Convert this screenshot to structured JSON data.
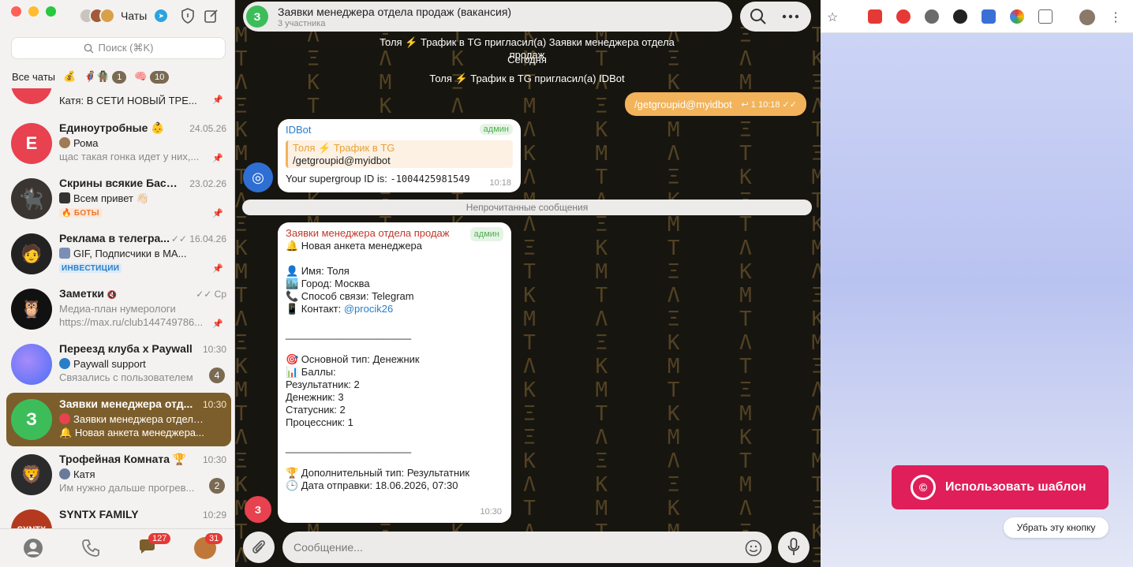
{
  "sidebar": {
    "title": "Чаты",
    "search_placeholder": "Поиск (⌘K)",
    "folders": [
      {
        "label": "Все чаты"
      },
      {
        "label": "💰"
      },
      {
        "label": "🦸🧌",
        "count": "1"
      },
      {
        "label": "🧠",
        "count": "10"
      }
    ],
    "chats": [
      {
        "name": "",
        "line2": "Катя: В СЕТИ НОВЫЙ ТРЕ...",
        "line3": "",
        "time": "",
        "avatar_letter": "",
        "avatar_color": "#e8414f"
      },
      {
        "name": "Единоутробные 👶",
        "line2": "Рома",
        "line3": "щас такая гонка идет у них,...",
        "time": "24.05.26",
        "avatar_letter": "Е",
        "avatar_color": "#e8414f"
      },
      {
        "name": "Скрины всякие Бася...",
        "line2": "Всем привет 👋🏻",
        "line3": "🔥 БОТЫ",
        "time": "23.02.26",
        "avatar_letter": "",
        "avatar_color": "#3a3530"
      },
      {
        "name": "Реклама в телегра...",
        "line2": "GIF, Подписчики в МА...",
        "line3": "ИНВЕСТИЦИИ",
        "time": "16.04.26",
        "avatar_letter": "",
        "avatar_color": "#222"
      },
      {
        "name": "Заметки",
        "line2": "Медиа-план нумерологи",
        "line3": "https://max.ru/club144749786...",
        "time": "Ср",
        "avatar_letter": "",
        "avatar_color": "#111"
      },
      {
        "name": "Переезд клуба х Paywall",
        "line2": "Paywall support",
        "line3": "Связались с пользователем",
        "time": "10:30",
        "count": "4",
        "avatar_letter": "",
        "avatar_color": "#6a5cd6"
      },
      {
        "name": "Заявки менеджера отд...",
        "line2": "Заявки менеджера отдела п...",
        "line3": "Новая анкета менеджера...",
        "time": "10:30",
        "avatar_letter": "З",
        "avatar_color": "#3dbd5a"
      },
      {
        "name": "Трофейная Комната 🏆",
        "line2": "Катя",
        "line3": "Им нужно дальше прогрев...",
        "time": "10:30",
        "count": "2",
        "avatar_letter": "",
        "avatar_color": "#2b2b2b"
      },
      {
        "name": "SYNTX FAMILY",
        "line2": "",
        "line3": "",
        "time": "10:29",
        "avatar_letter": "",
        "avatar_color": "#b33a1f"
      }
    ],
    "bottom": {
      "chats_badge": "127",
      "profile_badge": "31"
    }
  },
  "chat": {
    "title": "Заявки менеджера отдела продаж (вакансия)",
    "subtitle": "3 участника",
    "avatar_letter": "З",
    "system1": "Толя ⚡ Трафик в TG пригласил(а)  Заявки менеджера отдела продаж",
    "date_divider": "Сегодня",
    "system2": "Толя ⚡ Трафик в TG пригласил(а)  IDBot",
    "outgoing": {
      "text": "/getgroupid@myidbot",
      "meta": "↩ 1 10:18 ✓✓"
    },
    "bot_msg": {
      "sender": "IDBot",
      "admin": "админ",
      "quote_name": "Толя ⚡ Трафик в TG",
      "quote_text": "/getgroupid@myidbot",
      "text_prefix": "Your supergroup ID is: ",
      "group_id": "-1004425981549",
      "time": "10:18"
    },
    "unread_label": "Непрочитанные сообщения",
    "form_msg": {
      "sender": "Заявки менеджера отдела продаж",
      "admin": "админ",
      "lines": [
        "🔔 Новая анкета менеджера",
        "",
        "👤 Имя: Толя",
        "🏙️ Город: Москва",
        "📞 Способ связи: Telegram",
        "📱 Контакт: ",
        "",
        "______________________",
        "",
        "🎯 Основной тип: Денежник",
        "📊 Баллы:",
        "Результатник: 2",
        "Денежник: 3",
        "Статусник: 2",
        "Процессник: 1",
        "",
        "______________________",
        "",
        "🏆 Дополнительный тип: Результатник",
        "🕒 Дата отправки: 18.06.2026, 07:30"
      ],
      "contact_link": "@procik26",
      "time": "10:30",
      "avatar_letter": "З"
    },
    "composer_placeholder": "Сообщение..."
  },
  "browser": {
    "use_template": "Использовать шаблон",
    "remove_button": "Убрать эту кнопку"
  },
  "colors": {
    "accent": "#7c5e2c",
    "outgoing": "#f2b35a",
    "template_btn": "#e01e5a"
  }
}
